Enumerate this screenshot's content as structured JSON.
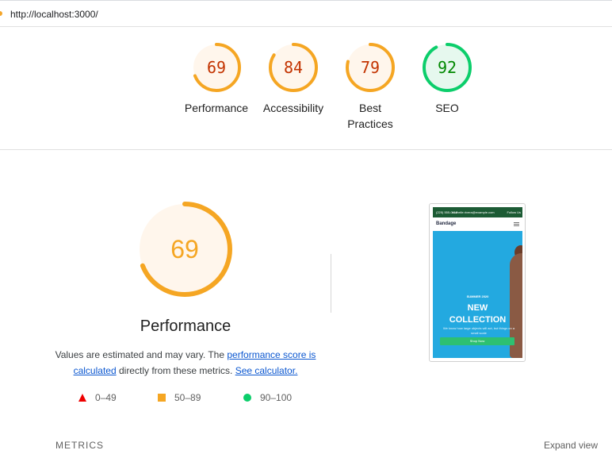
{
  "url": "http://localhost:3000/",
  "gauges": [
    {
      "score": 69,
      "label_lines": [
        "Performance"
      ],
      "ring": "#f5a623",
      "fill": "#fff6ec",
      "text": "#c33300"
    },
    {
      "score": 84,
      "label_lines": [
        "Accessibility"
      ],
      "ring": "#f5a623",
      "fill": "#fff6ec",
      "text": "#c33300"
    },
    {
      "score": 79,
      "label_lines": [
        "Best",
        "Practices"
      ],
      "ring": "#f5a623",
      "fill": "#fff6ec",
      "text": "#c33300"
    },
    {
      "score": 92,
      "label_lines": [
        "SEO"
      ],
      "ring": "#0cce6b",
      "fill": "#e6f8ee",
      "text": "#008800"
    }
  ],
  "performance": {
    "score": 69,
    "ring": "#f5a623",
    "fill": "#fff6ec",
    "text_color": "#f5a623",
    "title": "Performance",
    "desc_pre": "Values are estimated and may vary. The ",
    "desc_link1": "performance score is calculated",
    "desc_mid": " directly from these metrics. ",
    "desc_link2": "See calculator."
  },
  "legend": [
    {
      "range": "0–49",
      "shape": "triangle",
      "color": "#ee0000"
    },
    {
      "range": "50–89",
      "shape": "square",
      "color": "#f5a623"
    },
    {
      "range": "90–100",
      "shape": "circle",
      "color": "#0cce6b"
    }
  ],
  "screenshot": {
    "top_left": "(225) 555-0118",
    "top_email": "michelle.rivera@example.com",
    "top_follow": "Follow Us",
    "brand": "Bandage",
    "season": "SUMMER 2020",
    "headline_1": "NEW",
    "headline_2": "COLLECTION",
    "sub": "We know how large objects will act, but things on a small scale",
    "button": "Shop Now"
  },
  "metrics": {
    "label": "METRICS",
    "expand": "Expand view"
  }
}
